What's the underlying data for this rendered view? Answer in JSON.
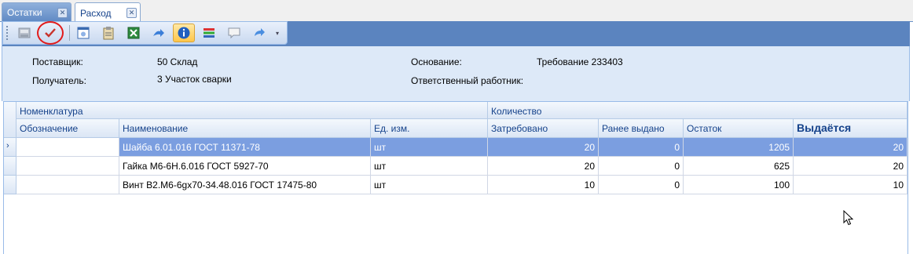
{
  "tabs": [
    {
      "label": "Остатки",
      "active": false
    },
    {
      "label": "Расход",
      "active": true
    }
  ],
  "toolbar": {
    "buttons": [
      {
        "name": "save-icon"
      },
      {
        "name": "checkmark-icon",
        "highlighted": true
      },
      {
        "name": "document-icon"
      },
      {
        "name": "clipboard-icon"
      },
      {
        "name": "excel-icon"
      },
      {
        "name": "forward-arrows-icon"
      },
      {
        "name": "info-icon",
        "active": true
      },
      {
        "name": "stack-icon"
      },
      {
        "name": "comment-icon"
      },
      {
        "name": "redo-arrow-icon"
      },
      {
        "name": "dropdown-icon"
      }
    ]
  },
  "details": {
    "supplier_label": "Поставщик:",
    "supplier_value": "50 Склад",
    "receiver_label": "Получатель:",
    "receiver_value": "3 Участок  сварки",
    "basis_label": "Основание:",
    "basis_value": "Требование 233403",
    "responsible_label": "Ответственный работник:",
    "responsible_value": ""
  },
  "grid": {
    "group_headers": {
      "nomenclature": "Номенклатура",
      "quantity": "Количество"
    },
    "columns": [
      "Обозначение",
      "Наименование",
      "Ед. изм.",
      "Затребовано",
      "Ранее выдано",
      "Остаток",
      "Выдаётся"
    ],
    "rows": [
      {
        "designation": "",
        "name": "Шайба 6.01.016 ГОСТ 11371-78",
        "unit": "шт",
        "requested": "20",
        "issued_before": "0",
        "remainder": "1205",
        "issuing": "20",
        "selected": true
      },
      {
        "designation": "",
        "name": "Гайка М6-6Н.6.016 ГОСТ 5927-70",
        "unit": "шт",
        "requested": "20",
        "issued_before": "0",
        "remainder": "625",
        "issuing": "20",
        "selected": false
      },
      {
        "designation": "",
        "name": "Винт В2.М6-6gx70-34.48.016 ГОСТ 17475-80",
        "unit": "шт",
        "requested": "10",
        "issued_before": "0",
        "remainder": "100",
        "issuing": "10",
        "selected": false
      }
    ],
    "selected_row_marker": "›"
  }
}
